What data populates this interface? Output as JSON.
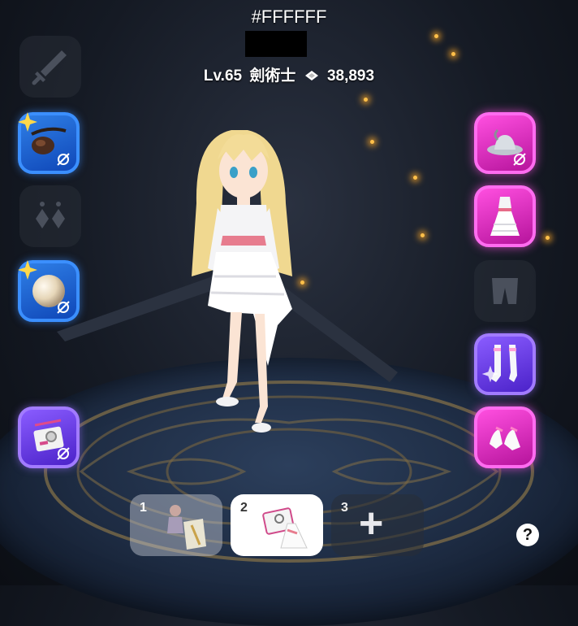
{
  "header": {
    "name": "#FFFFFF",
    "level": "Lv.65",
    "job": "劍術士",
    "power": "38,893"
  },
  "slots": {
    "left": [
      "weapon-slot-empty",
      "eyepatch-accessory",
      "earring-slot-empty",
      "pearl-accessory",
      "camera-bag-item"
    ],
    "right": [
      "hat-item",
      "dress-item",
      "pants-slot-empty",
      "stockings-item",
      "shoes-item"
    ]
  },
  "tabs": [
    {
      "number": "1"
    },
    {
      "number": "2"
    },
    {
      "number": "3"
    }
  ],
  "add_symbol": "+",
  "help_symbol": "?",
  "colors": {
    "blue_slot": "#2f7fe6",
    "pink_slot": "#ff4fe0",
    "purple_slot": "#8a5cff",
    "spark": "#ffc04a"
  }
}
